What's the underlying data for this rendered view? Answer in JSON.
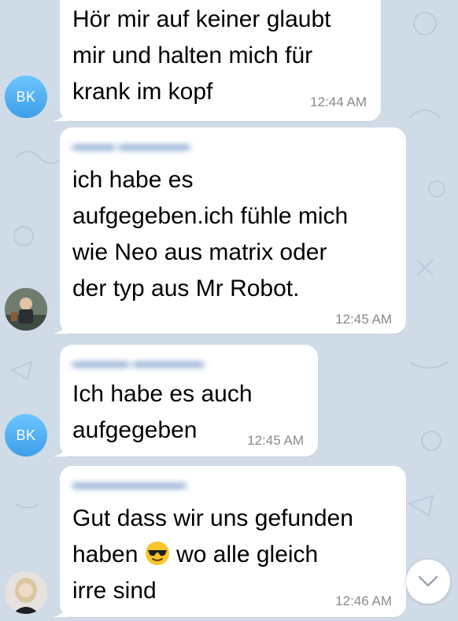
{
  "messages": [
    {
      "avatar_initials": "BK",
      "lines": [
        "Hör mir auf keiner glaubt",
        "mir und halten mich für",
        "krank im kopf"
      ],
      "time": "12:44 AM"
    },
    {
      "lines": [
        "ich habe es",
        "aufgegeben.ich fühle mich",
        "wie Neo aus matrix oder",
        "der typ aus Mr Robot."
      ],
      "time": "12:45 AM"
    },
    {
      "avatar_initials": "BK",
      "lines": [
        "Ich habe es auch",
        "aufgegeben"
      ],
      "time": "12:45 AM"
    },
    {
      "line1": "Gut dass wir uns gefunden",
      "line2_a": "haben",
      "line2_b": "wo alle gleich",
      "line3": "irre sind",
      "emoji": "smiling-face-with-sunglasses",
      "time": "12:46 AM"
    }
  ],
  "icons": {
    "scroll_down": "chevron-down-icon"
  },
  "colors": {
    "background": "#cfdce8",
    "bubble": "#ffffff",
    "avatar_bk": "#4aa9f0",
    "time_text": "#8a8a8a"
  }
}
